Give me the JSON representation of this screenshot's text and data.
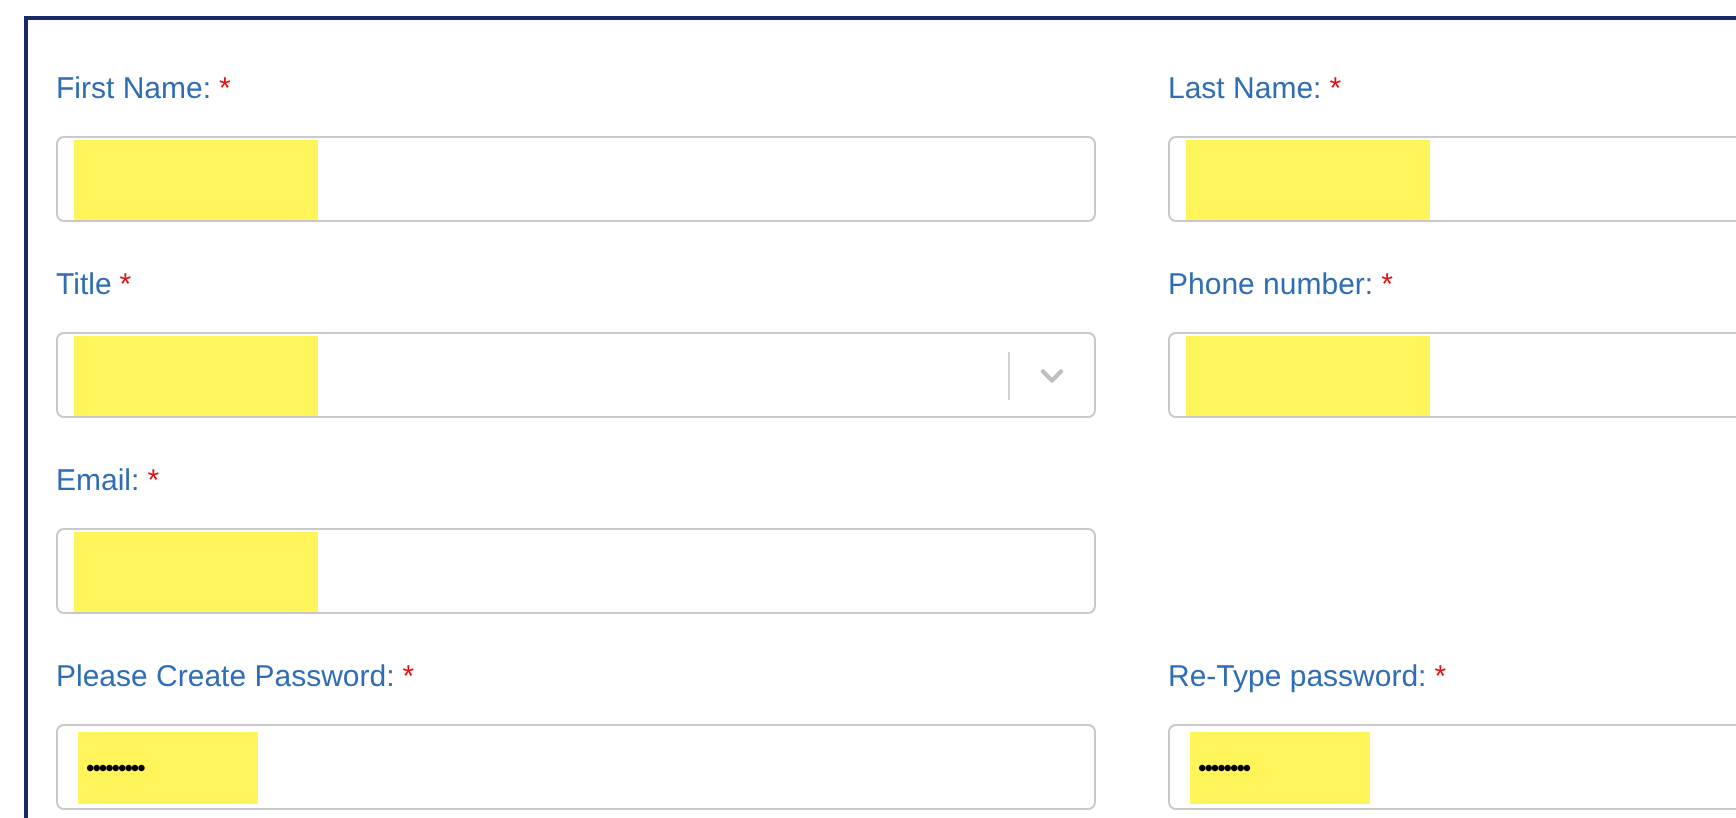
{
  "rows": [
    {
      "fields": [
        {
          "kind": "text",
          "label": "First Name:",
          "required": true,
          "redacted": true
        },
        {
          "kind": "text",
          "label": "Last Name:",
          "required": true,
          "redacted": true
        }
      ]
    },
    {
      "fields": [
        {
          "kind": "select",
          "label": "Title",
          "required": true,
          "redacted": true
        },
        {
          "kind": "text",
          "label": "Phone number:",
          "required": true,
          "redacted": true
        }
      ]
    },
    {
      "fields": [
        {
          "kind": "text",
          "label": "Email:",
          "required": true,
          "redacted": true
        }
      ]
    },
    {
      "fields": [
        {
          "kind": "password",
          "label": "Please Create Password:",
          "required": true,
          "value": "•••••••••",
          "redacted": true
        },
        {
          "kind": "password",
          "label": "Re-Type password:",
          "required": true,
          "value": "••••••••",
          "redacted": true
        }
      ]
    }
  ],
  "required_mark": "*"
}
